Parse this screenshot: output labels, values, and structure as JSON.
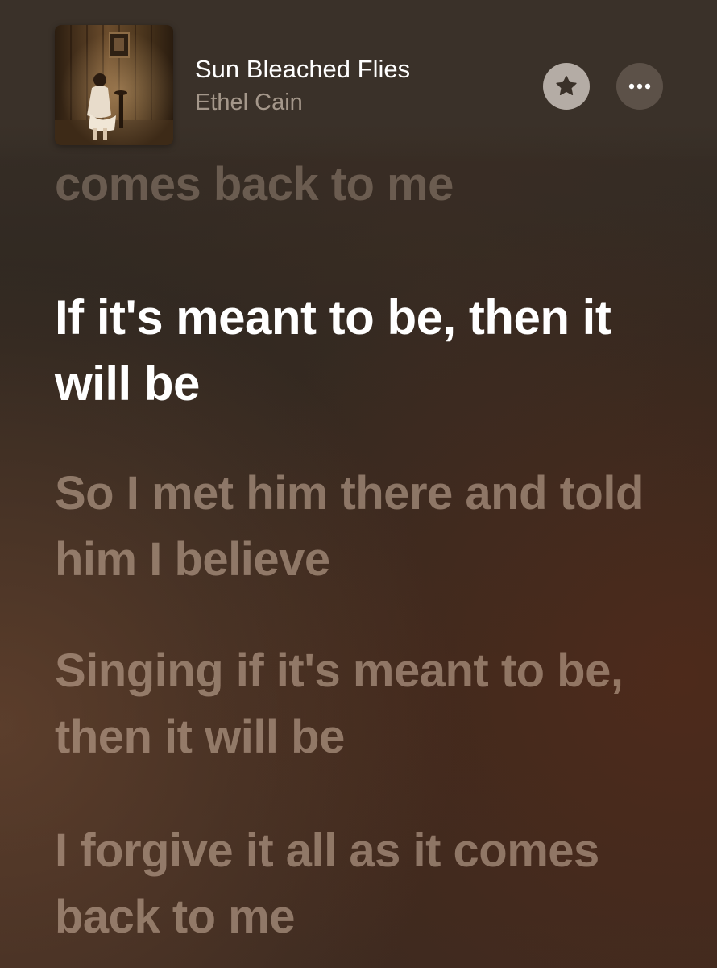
{
  "now_playing": {
    "title": "Sun Bleached Flies",
    "artist": "Ethel Cain"
  },
  "actions": {
    "favorite_icon": "star-icon",
    "more_icon": "ellipsis-icon"
  },
  "lyrics": {
    "lines": [
      "comes back to me",
      "If it's meant to be, then it will be",
      "So I met him there and told him I believe",
      "Singing if it's meant to be, then it will be",
      "I forgive it all as it comes back to me"
    ],
    "active_index": 1
  },
  "colors": {
    "active_lyric": "#ffffff",
    "inactive_lyric": "#cdb4a0",
    "favorite_button": "#b4aca5",
    "icon_dark": "#3a3129"
  }
}
